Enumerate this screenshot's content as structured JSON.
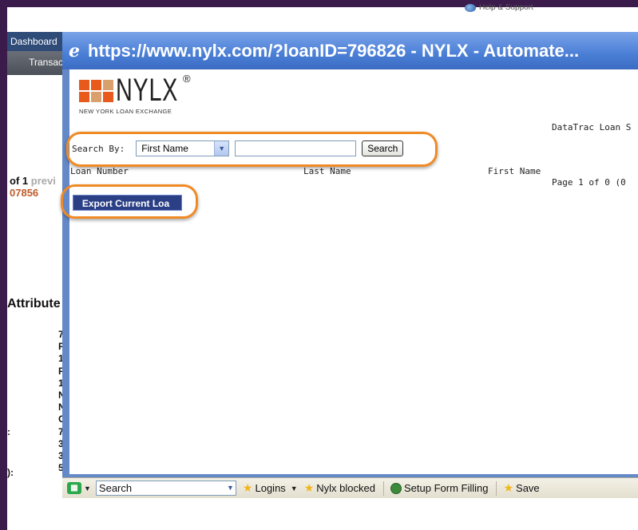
{
  "background": {
    "help_link": "Help & Support",
    "nav_tab1": "Dashboard",
    "nav_tab2": "Transac",
    "pager_strong": "of 1",
    "pager_prev": "previ",
    "loan_number": "07856",
    "attributes_heading": "Attribute",
    "side_letters": [
      "7",
      "F",
      "1",
      "F",
      "1",
      "N",
      "N",
      "C",
      "7",
      "3",
      "3",
      "5"
    ],
    "colon_marks": [
      ":",
      "):"
    ]
  },
  "popup": {
    "title": "https://www.nylx.com/?loanID=796826 - NYLX - Automate...",
    "logo": {
      "word": "NYLX",
      "registered": "®",
      "subtitle": "NEW YORK LOAN EXCHANGE"
    },
    "datatrac_label": "DataTrac Loan S",
    "search": {
      "label": "Search By:",
      "selected_option": "First Name",
      "input_value": "",
      "button_label": "Search"
    },
    "columns": [
      "Loan Number",
      "Last Name",
      "First Name"
    ],
    "page_info": "Page 1 of 0 (0",
    "export_button": "Export Current Loa"
  },
  "toolbar": {
    "search_value": "Search",
    "items": [
      "Logins",
      "Nylx blocked",
      "Setup Form Filling",
      "Save"
    ]
  },
  "colors": {
    "frame": "#3b1a4c",
    "window_title": "#4a7ed6",
    "highlight_oval": "#f08a24",
    "export_button": "#2b3f86",
    "logo_orange": "#e8591c"
  }
}
